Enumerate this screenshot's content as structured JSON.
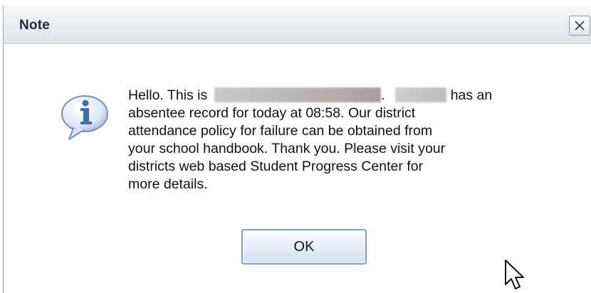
{
  "dialog": {
    "title": "Note",
    "close_icon": "close-icon",
    "info_icon": "info-speech-bubble-icon",
    "message": {
      "line1_prefix": "Hello. This is",
      "line1_separator": ".",
      "line1_suffix": "has an",
      "line2": "absentee record for today at 08:58. Our district",
      "line3": "attendance policy for failure can be obtained from",
      "line4": "your school handbook. Thank you. Please visit your",
      "line5": "districts web based Student Progress Center for",
      "line6": "more details."
    },
    "ok_label": "OK"
  },
  "colors": {
    "title_bar_top": "#f7f8fa",
    "title_bar_bottom": "#dfe4ea",
    "ok_border": "#7aa2cc",
    "info_icon_blue": "#3b6fb6"
  }
}
